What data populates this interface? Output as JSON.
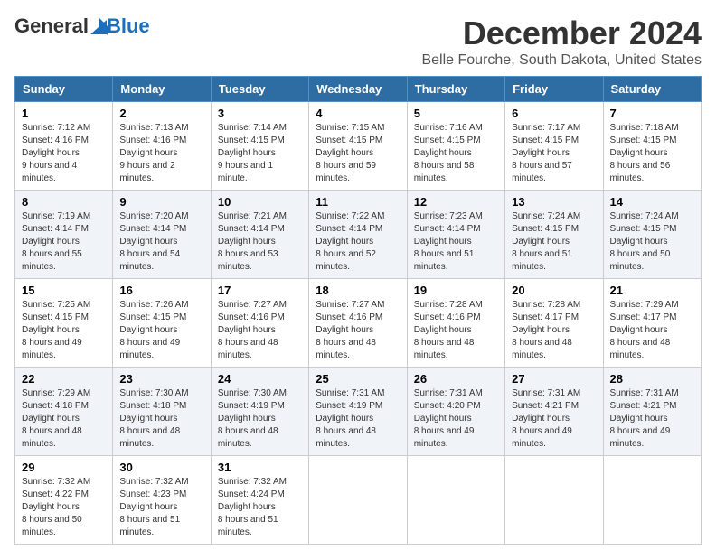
{
  "header": {
    "logo_general": "General",
    "logo_blue": "Blue",
    "month_title": "December 2024",
    "location": "Belle Fourche, South Dakota, United States"
  },
  "weekdays": [
    "Sunday",
    "Monday",
    "Tuesday",
    "Wednesday",
    "Thursday",
    "Friday",
    "Saturday"
  ],
  "weeks": [
    [
      {
        "day": "1",
        "sunrise": "7:12 AM",
        "sunset": "4:16 PM",
        "daylight": "9 hours and 4 minutes."
      },
      {
        "day": "2",
        "sunrise": "7:13 AM",
        "sunset": "4:16 PM",
        "daylight": "9 hours and 2 minutes."
      },
      {
        "day": "3",
        "sunrise": "7:14 AM",
        "sunset": "4:15 PM",
        "daylight": "9 hours and 1 minute."
      },
      {
        "day": "4",
        "sunrise": "7:15 AM",
        "sunset": "4:15 PM",
        "daylight": "8 hours and 59 minutes."
      },
      {
        "day": "5",
        "sunrise": "7:16 AM",
        "sunset": "4:15 PM",
        "daylight": "8 hours and 58 minutes."
      },
      {
        "day": "6",
        "sunrise": "7:17 AM",
        "sunset": "4:15 PM",
        "daylight": "8 hours and 57 minutes."
      },
      {
        "day": "7",
        "sunrise": "7:18 AM",
        "sunset": "4:15 PM",
        "daylight": "8 hours and 56 minutes."
      }
    ],
    [
      {
        "day": "8",
        "sunrise": "7:19 AM",
        "sunset": "4:14 PM",
        "daylight": "8 hours and 55 minutes."
      },
      {
        "day": "9",
        "sunrise": "7:20 AM",
        "sunset": "4:14 PM",
        "daylight": "8 hours and 54 minutes."
      },
      {
        "day": "10",
        "sunrise": "7:21 AM",
        "sunset": "4:14 PM",
        "daylight": "8 hours and 53 minutes."
      },
      {
        "day": "11",
        "sunrise": "7:22 AM",
        "sunset": "4:14 PM",
        "daylight": "8 hours and 52 minutes."
      },
      {
        "day": "12",
        "sunrise": "7:23 AM",
        "sunset": "4:14 PM",
        "daylight": "8 hours and 51 minutes."
      },
      {
        "day": "13",
        "sunrise": "7:24 AM",
        "sunset": "4:15 PM",
        "daylight": "8 hours and 51 minutes."
      },
      {
        "day": "14",
        "sunrise": "7:24 AM",
        "sunset": "4:15 PM",
        "daylight": "8 hours and 50 minutes."
      }
    ],
    [
      {
        "day": "15",
        "sunrise": "7:25 AM",
        "sunset": "4:15 PM",
        "daylight": "8 hours and 49 minutes."
      },
      {
        "day": "16",
        "sunrise": "7:26 AM",
        "sunset": "4:15 PM",
        "daylight": "8 hours and 49 minutes."
      },
      {
        "day": "17",
        "sunrise": "7:27 AM",
        "sunset": "4:16 PM",
        "daylight": "8 hours and 48 minutes."
      },
      {
        "day": "18",
        "sunrise": "7:27 AM",
        "sunset": "4:16 PM",
        "daylight": "8 hours and 48 minutes."
      },
      {
        "day": "19",
        "sunrise": "7:28 AM",
        "sunset": "4:16 PM",
        "daylight": "8 hours and 48 minutes."
      },
      {
        "day": "20",
        "sunrise": "7:28 AM",
        "sunset": "4:17 PM",
        "daylight": "8 hours and 48 minutes."
      },
      {
        "day": "21",
        "sunrise": "7:29 AM",
        "sunset": "4:17 PM",
        "daylight": "8 hours and 48 minutes."
      }
    ],
    [
      {
        "day": "22",
        "sunrise": "7:29 AM",
        "sunset": "4:18 PM",
        "daylight": "8 hours and 48 minutes."
      },
      {
        "day": "23",
        "sunrise": "7:30 AM",
        "sunset": "4:18 PM",
        "daylight": "8 hours and 48 minutes."
      },
      {
        "day": "24",
        "sunrise": "7:30 AM",
        "sunset": "4:19 PM",
        "daylight": "8 hours and 48 minutes."
      },
      {
        "day": "25",
        "sunrise": "7:31 AM",
        "sunset": "4:19 PM",
        "daylight": "8 hours and 48 minutes."
      },
      {
        "day": "26",
        "sunrise": "7:31 AM",
        "sunset": "4:20 PM",
        "daylight": "8 hours and 49 minutes."
      },
      {
        "day": "27",
        "sunrise": "7:31 AM",
        "sunset": "4:21 PM",
        "daylight": "8 hours and 49 minutes."
      },
      {
        "day": "28",
        "sunrise": "7:31 AM",
        "sunset": "4:21 PM",
        "daylight": "8 hours and 49 minutes."
      }
    ],
    [
      {
        "day": "29",
        "sunrise": "7:32 AM",
        "sunset": "4:22 PM",
        "daylight": "8 hours and 50 minutes."
      },
      {
        "day": "30",
        "sunrise": "7:32 AM",
        "sunset": "4:23 PM",
        "daylight": "8 hours and 51 minutes."
      },
      {
        "day": "31",
        "sunrise": "7:32 AM",
        "sunset": "4:24 PM",
        "daylight": "8 hours and 51 minutes."
      },
      null,
      null,
      null,
      null
    ]
  ]
}
